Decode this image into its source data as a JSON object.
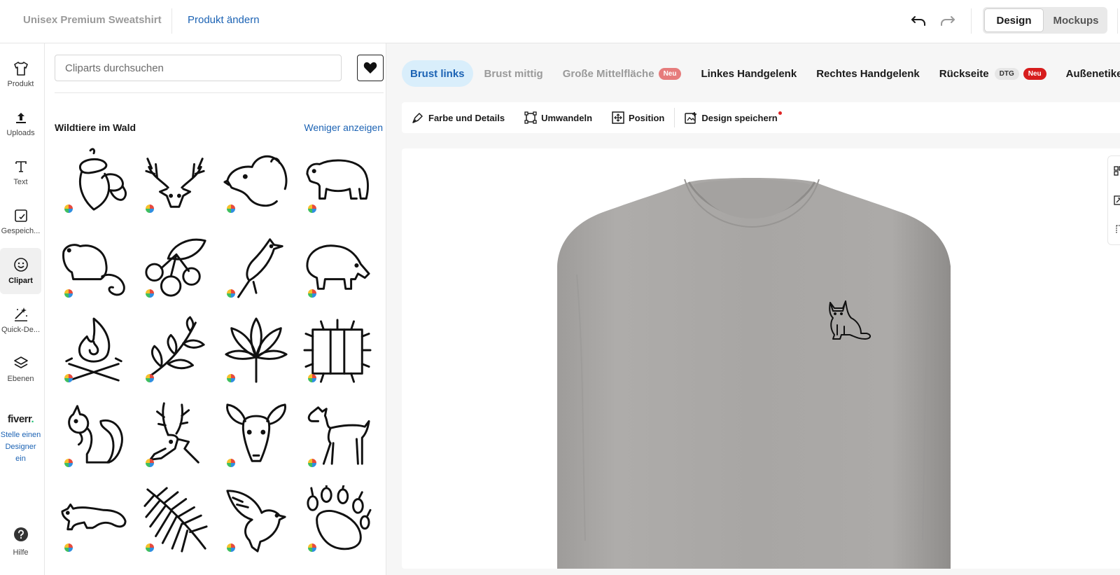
{
  "header": {
    "product_name": "Unisex Premium Sweatshirt",
    "change_product": "Produkt ändern",
    "mode_design": "Design",
    "mode_mockups": "Mockups"
  },
  "rail": {
    "items": [
      {
        "label": "Produkt",
        "icon": "tshirt-icon"
      },
      {
        "label": "Uploads",
        "icon": "upload-icon"
      },
      {
        "label": "Text",
        "icon": "text-icon"
      },
      {
        "label": "Gespeich...",
        "icon": "saved-icon"
      },
      {
        "label": "Clipart",
        "icon": "smiley-icon"
      },
      {
        "label": "Quick-De...",
        "icon": "sparkle-icon"
      },
      {
        "label": "Ebenen",
        "icon": "layers-icon"
      }
    ],
    "fiverr_logo": "fiverr",
    "fiverr_dot": ".",
    "fiverr_link": "Stelle einen Designer ein",
    "help": "Hilfe"
  },
  "clipart": {
    "search_placeholder": "Cliparts durchsuchen",
    "category_title": "Wildtiere im Wald",
    "show_less": "Weniger anzeigen"
  },
  "placements": {
    "items": [
      {
        "label": "Brust links"
      },
      {
        "label": "Brust mittig"
      },
      {
        "label": "Große Mittelfläche",
        "tag": "Neu"
      },
      {
        "label": "Linkes Handgelenk"
      },
      {
        "label": "Rechtes Handgelenk"
      },
      {
        "label": "Rückseite",
        "tag1": "DTG",
        "tag2": "Neu"
      },
      {
        "label": "Außenetikett"
      }
    ]
  },
  "toolbar": {
    "color_details": "Farbe und Details",
    "transform": "Umwandeln",
    "position": "Position",
    "save_design": "Design speichern"
  },
  "colors": {
    "accent": "#1c63b4",
    "active_placement_bg": "#d9eefb",
    "new_tag": "#d71d1d",
    "sweatshirt": "#a9a7a5"
  }
}
